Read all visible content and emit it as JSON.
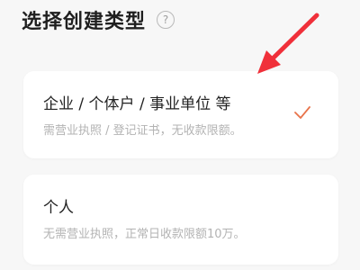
{
  "header": {
    "title": "选择创建类型",
    "help_glyph": "?"
  },
  "options": [
    {
      "title": "企业 / 个体户 / 事业单位 等",
      "description": "需营业执照 / 登记证书，无收款限额。",
      "selected": true
    },
    {
      "title": "个人",
      "description": "无需营业执照，正常日收款限额10万。",
      "selected": false
    }
  ],
  "colors": {
    "accent": "#e8734a",
    "annotation_arrow": "#f0303a",
    "card_background": "#ffffff",
    "page_background": "#f7f7f7"
  },
  "icons": {
    "help": "question-circle-icon",
    "check": "checkmark-icon",
    "annotation": "red-arrow-annotation"
  }
}
